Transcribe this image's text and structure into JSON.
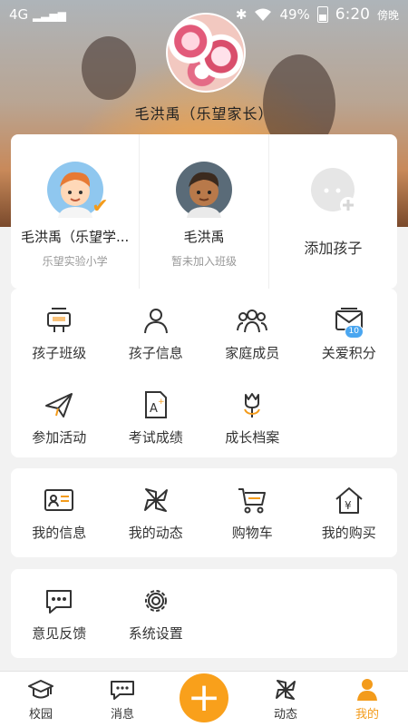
{
  "status": {
    "network": "4G",
    "bt": "✱",
    "battery": "49%",
    "time": "6:20",
    "period": "傍晚"
  },
  "profile": {
    "name": "毛洪禹（乐望家长）"
  },
  "children": [
    {
      "name": "毛洪禹（乐望学...",
      "school": "乐望实验小学"
    },
    {
      "name": "毛洪禹",
      "school": "暂未加入班级"
    }
  ],
  "add_child": {
    "label": "添加孩子"
  },
  "section1": [
    {
      "label": "孩子班级",
      "icon": "signboard-icon"
    },
    {
      "label": "孩子信息",
      "icon": "person-icon"
    },
    {
      "label": "家庭成员",
      "icon": "family-icon"
    },
    {
      "label": "关爱积分",
      "icon": "envelope-icon",
      "badge": "10"
    },
    {
      "label": "参加活动",
      "icon": "paper-plane-icon"
    },
    {
      "label": "考试成绩",
      "icon": "grade-paper-icon"
    },
    {
      "label": "成长档案",
      "icon": "tulip-icon"
    }
  ],
  "section2": [
    {
      "label": "我的信息",
      "icon": "id-card-icon"
    },
    {
      "label": "我的动态",
      "icon": "pinwheel-icon"
    },
    {
      "label": "购物车",
      "icon": "cart-icon"
    },
    {
      "label": "我的购买",
      "icon": "yen-house-icon"
    }
  ],
  "section3": [
    {
      "label": "意见反馈",
      "icon": "chat-icon"
    },
    {
      "label": "系统设置",
      "icon": "gear-icon"
    }
  ],
  "tabs": [
    {
      "label": "校园"
    },
    {
      "label": "消息"
    },
    {
      "label": "+"
    },
    {
      "label": "动态"
    },
    {
      "label": "我的"
    }
  ],
  "colors": {
    "accent": "#f39b1b",
    "badge": "#4aa6f0"
  }
}
